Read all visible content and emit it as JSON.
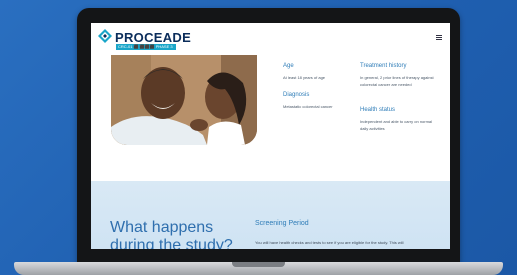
{
  "header": {
    "logo_main": "PROCEADE",
    "logo_tag": "CRC-01 ⬛ ⬛⬛⬛ PHASE 3"
  },
  "criteria": {
    "age": {
      "label": "Age",
      "value": "At least 18 years of age"
    },
    "diagnosis": {
      "label": "Diagnosis",
      "value": "Metastatic colorectal cancer"
    },
    "treatment": {
      "label": "Treatment history",
      "value": "In general, 2 prior lines of therapy against colorectal cancer are needed"
    },
    "health": {
      "label": "Health status",
      "value": "Independent and able to carry on normal daily activities"
    }
  },
  "study": {
    "title_line1": "What happens",
    "title_line2": "during the study?",
    "screening_title": "Screening Period",
    "screening_text": "You will have health checks and tests to see if you are eligible for the study. This will"
  },
  "colors": {
    "accent": "#1aa6c9",
    "navy": "#0b2d5b",
    "background": "#2a6fc0"
  }
}
